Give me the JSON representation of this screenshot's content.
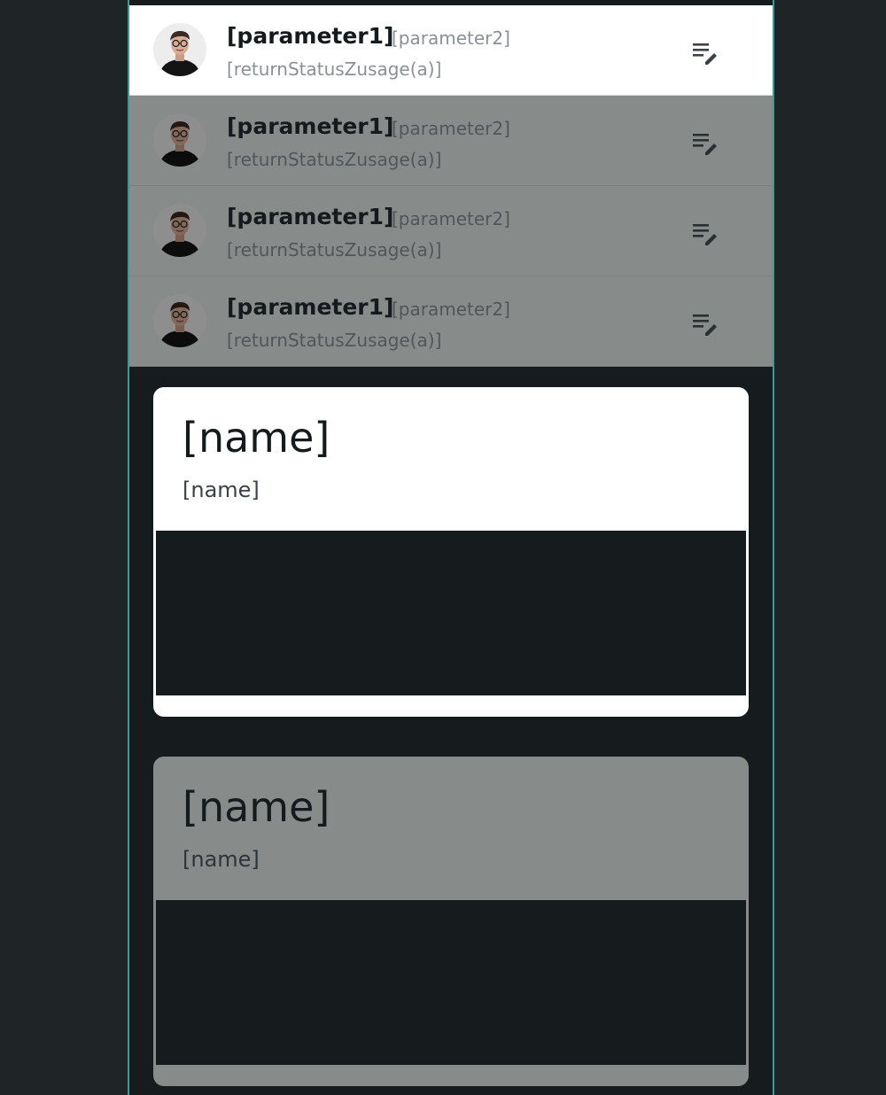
{
  "list": {
    "items": [
      {
        "parameter1": "[parameter1]",
        "parameter2": "[parameter2]",
        "status": "[returnStatusZusage(a)]",
        "state": "active",
        "avatar_icon": "person-avatar-icon",
        "action_icon": "edit-note-icon"
      },
      {
        "parameter1": "[parameter1]",
        "parameter2": "[parameter2]",
        "status": "[returnStatusZusage(a)]",
        "state": "dim",
        "avatar_icon": "person-avatar-icon",
        "action_icon": "edit-note-icon"
      },
      {
        "parameter1": "[parameter1]",
        "parameter2": "[parameter2]",
        "status": "[returnStatusZusage(a)]",
        "state": "dim",
        "avatar_icon": "person-avatar-icon",
        "action_icon": "edit-note-icon"
      },
      {
        "parameter1": "[parameter1]",
        "parameter2": "[parameter2]",
        "status": "[returnStatusZusage(a)]",
        "state": "dim",
        "avatar_icon": "person-avatar-icon",
        "action_icon": "edit-note-icon"
      }
    ]
  },
  "cards": [
    {
      "title": "[name]",
      "subtitle": "[name]",
      "state": "active"
    },
    {
      "title": "[name]",
      "subtitle": "[name]",
      "state": "dim"
    }
  ],
  "colors": {
    "background": "#1f2427",
    "frame": "#161b1e",
    "frame_border": "#3a9d8f",
    "active_surface": "#ffffff",
    "dim_surface": "#878b89"
  }
}
